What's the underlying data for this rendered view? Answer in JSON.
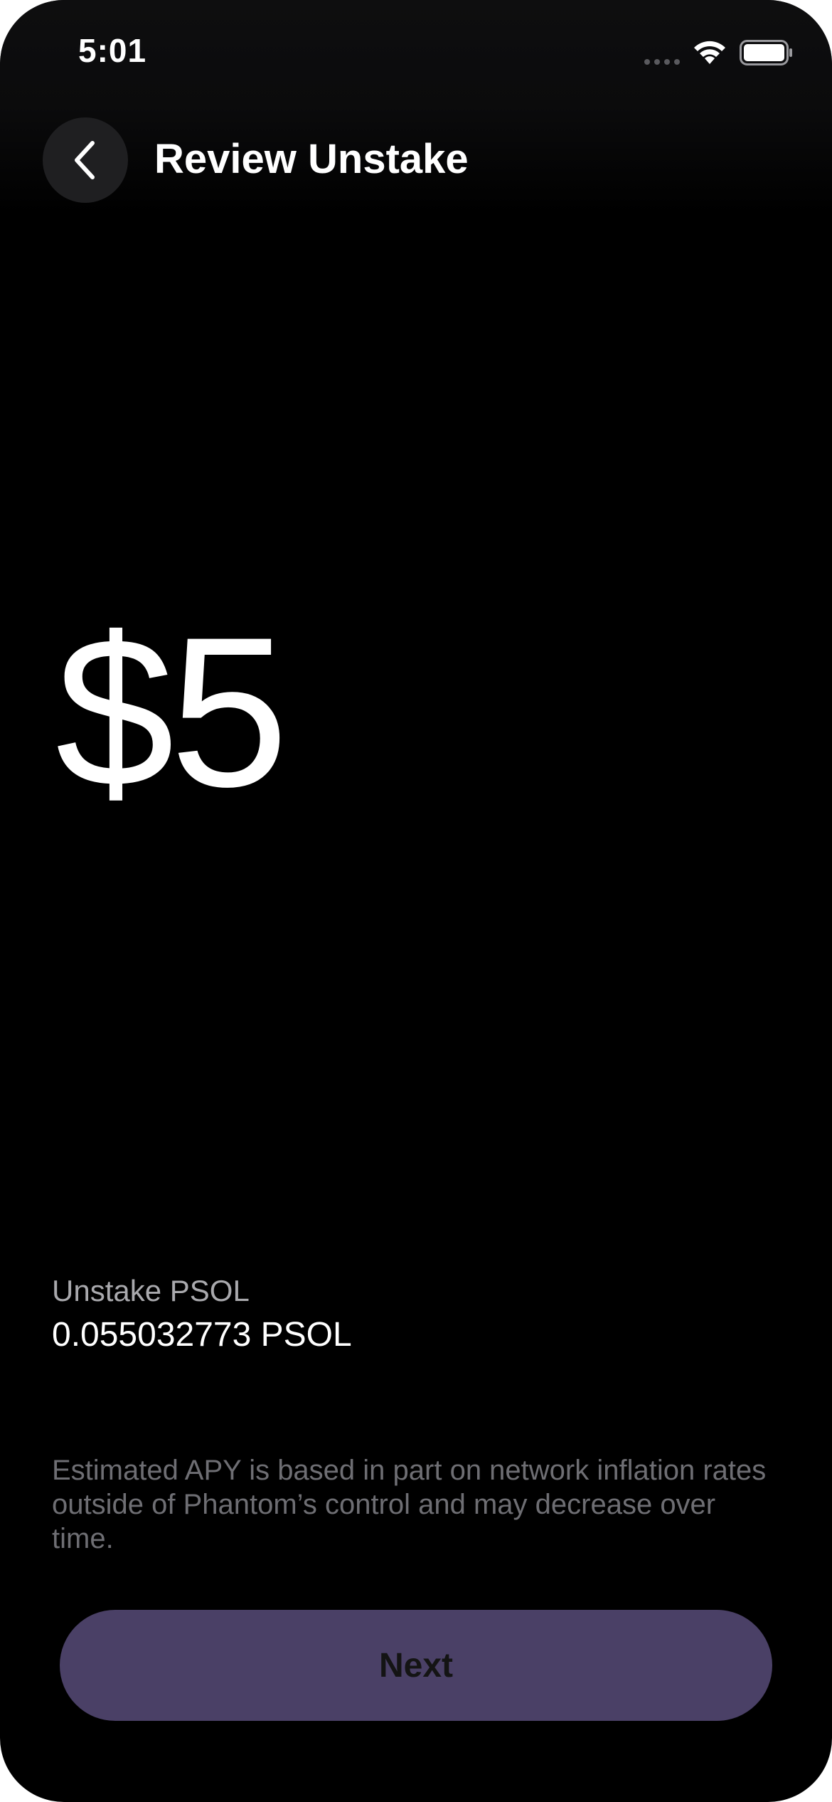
{
  "status_bar": {
    "time": "5:01",
    "icons": [
      "signal-icon",
      "wifi-icon",
      "battery-icon"
    ]
  },
  "header": {
    "title": "Review Unstake",
    "back_icon": "chevron-left-icon"
  },
  "main": {
    "amount": "$5",
    "detail": {
      "label": "Unstake PSOL",
      "value": "0.055032773 PSOL"
    },
    "disclaimer": "Estimated APY is based in part on network inflation rates outside of Phantom’s control and may decrease over time."
  },
  "footer": {
    "next_label": "Next"
  },
  "colors": {
    "background": "#000000",
    "button": "#4a4066",
    "button_text": "#141414",
    "secondary_text": "#a9a9ad",
    "disclaimer_text": "#6e6e73"
  }
}
